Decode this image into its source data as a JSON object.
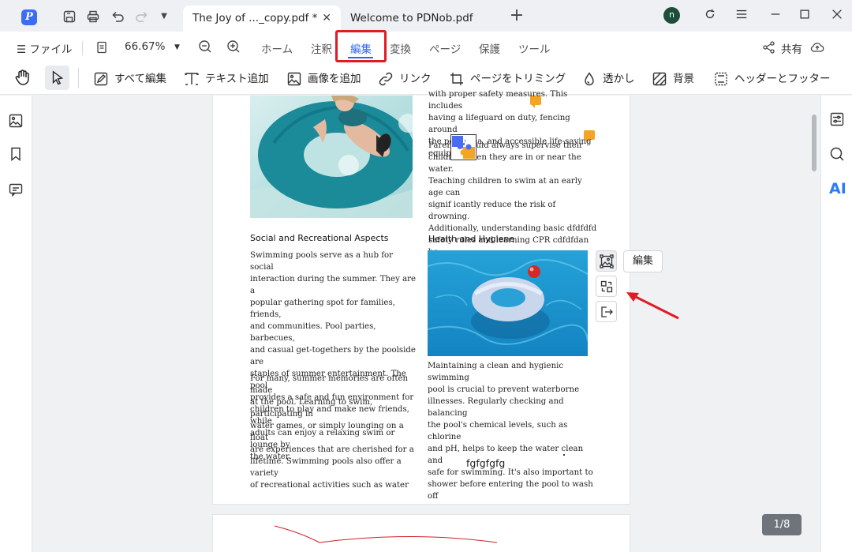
{
  "titlebar": {
    "tabs": [
      {
        "label": "The Joy of ..._copy.pdf *",
        "close": "✕"
      },
      {
        "label": "Welcome to PDNob.pdf"
      }
    ],
    "avatar_initial": "n"
  },
  "menubar": {
    "file_label": "ファイル",
    "zoom": "66.67%",
    "items": [
      "ホーム",
      "注釈",
      "編集",
      "変換",
      "ページ",
      "保護",
      "ツール"
    ],
    "share_label": "共有"
  },
  "toolbar": {
    "items": [
      "すべて編集",
      "テキスト追加",
      "画像を追加",
      "リンク",
      "ページをトリミング",
      "透かし",
      "背景",
      "ヘッダーとフッター"
    ]
  },
  "document": {
    "top_right_text": "with proper safety measures. This includes\nhaving a lifeguard on duty, fencing around\nthe pool area, and accessible life-saving\nequipment.",
    "parents_text": "Parents should always supervise their\nchildren when they are in or near the water.\nTeaching children to swim at an early age can\nsignif  icantly reduce the risk of drowning.\nAdditionally, understanding basic dfdfdfd\nsafety rules and learning CPR cdfdfdan be\nlifesaving skillsdfdfdfdfd.",
    "social_heading": "Social and Recreational Aspects",
    "social_p1": "Swimming pools serve as a hub for social\ninteraction during the summer. They are a\npopular gathering spot for families, friends,\nand communities. Pool parties, barbecues,\nand casual get-togethers by the poolside are\nstaples of summer entertainment. The pool\nprovides a safe and fun environment for\nchildren to play and make new friends, while\nadults can enjoy a relaxing swim or lounge by\nthe water.",
    "social_p2": "For many, summer memories are often made\nat the pool. Learning to swim, participating in\nwater games, or simply lounging on a float\nare experiences that are cherished for a\nlifetime. Swimming pools also offer a variety\nof recreational activities such as water",
    "health_heading": "Health and Hygiene",
    "health_p1": "Maintaining a clean and hygienic swimming\npool is crucial to prevent waterborne\nillnesses. Regularly checking and balancing\nthe pool's chemical levels, such as chlorine\nand pH, helps to keep the water clean and\nsafe for swimming. It's also important to\nshower before entering the pool to wash off",
    "footer": "fgfgfgfg"
  },
  "image_toolbar": {
    "edit_popup": "編集"
  },
  "page_indicator": "1/8",
  "colors": {
    "accent": "#2b64f5",
    "highlight_box": "#e01b24",
    "annotation_arrow": "#e01b24"
  }
}
